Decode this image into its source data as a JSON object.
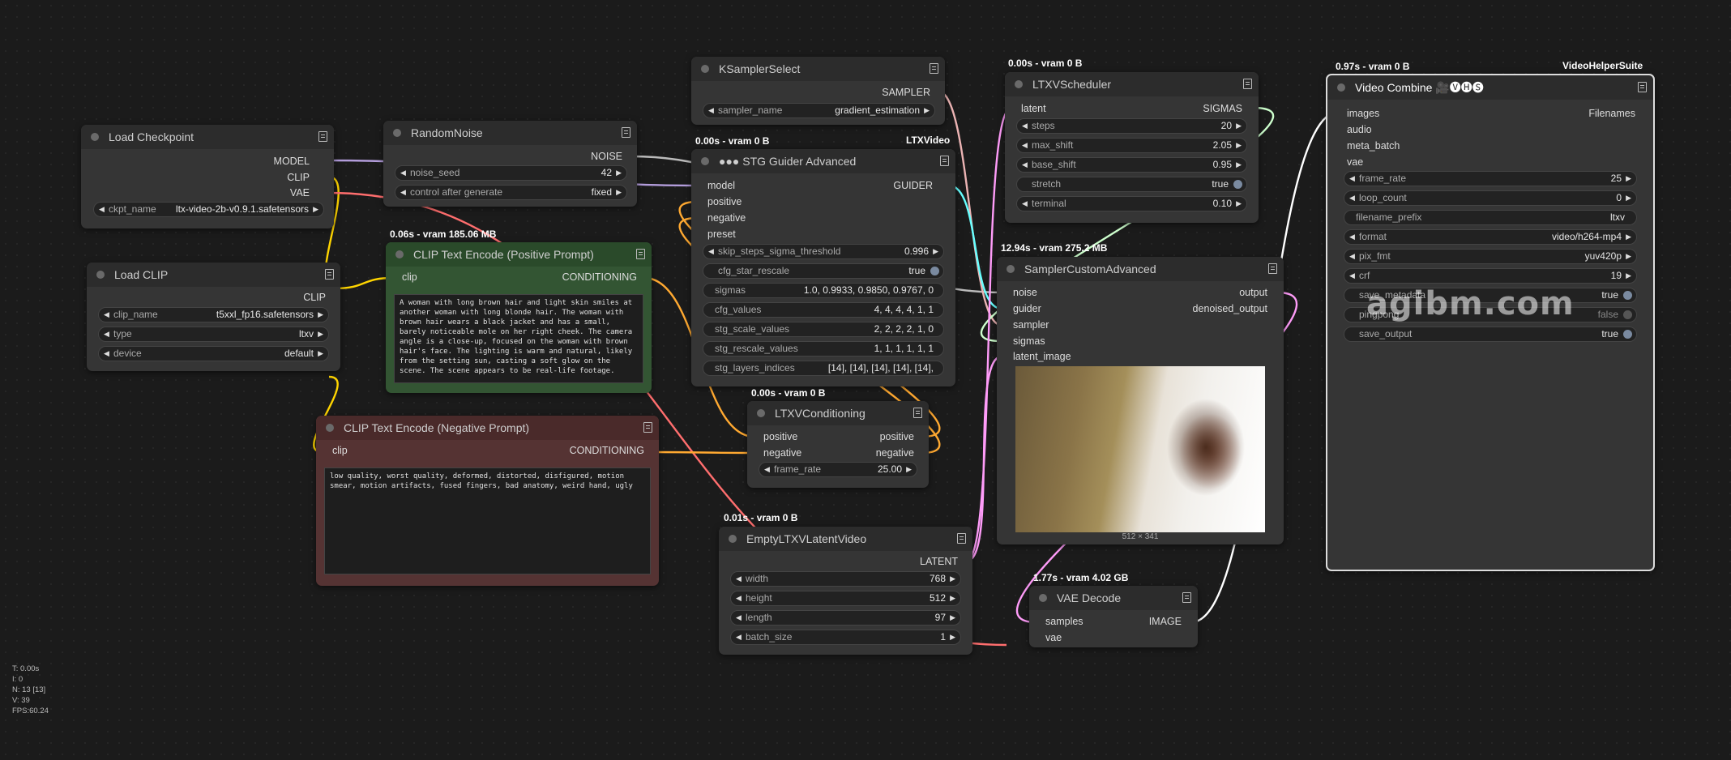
{
  "colors": {
    "model": "#b39ddb",
    "clip": "#ffd500",
    "vae": "#ff6e6e",
    "conditioning": "#ffa931",
    "latent": "#ff9cf9",
    "noise": "#bbbbbb",
    "guider": "#66ffff",
    "sigmas": "#cdffcd",
    "image": "#64b5f6",
    "sampler": "#ecb4b4"
  },
  "nodes": {
    "load_checkpoint": {
      "title": "Load Checkpoint",
      "outputs": [
        "MODEL",
        "CLIP",
        "VAE"
      ],
      "ckpt_name": {
        "name": "ckpt_name",
        "value": "ltx-video-2b-v0.9.1.safetensors"
      }
    },
    "random_noise": {
      "title": "RandomNoise",
      "output": "NOISE",
      "noise_seed": {
        "name": "noise_seed",
        "value": "42"
      },
      "control": {
        "name": "control after generate",
        "value": "fixed"
      }
    },
    "ksampler_select": {
      "title": "KSamplerSelect",
      "output": "SAMPLER",
      "sampler_name": {
        "name": "sampler_name",
        "value": "gradient_estimation"
      }
    },
    "stg_guider": {
      "badge": "0.00s - vram 0 B",
      "group": "LTXVideo",
      "title": "●●● STG Guider Advanced",
      "inputs": [
        "model",
        "positive",
        "negative",
        "preset"
      ],
      "output": "GUIDER",
      "widgets": [
        {
          "name": "skip_steps_sigma_threshold",
          "value": "0.996"
        },
        {
          "name": "cfg_star_rescale",
          "value": "true"
        },
        {
          "name": "sigmas",
          "value": "1.0, 0.9933, 0.9850, 0.9767, 0"
        },
        {
          "name": "cfg_values",
          "value": "4, 4, 4, 4, 1, 1"
        },
        {
          "name": "stg_scale_values",
          "value": "2, 2, 2, 2, 1, 0"
        },
        {
          "name": "stg_rescale_values",
          "value": "1, 1, 1, 1, 1, 1"
        },
        {
          "name": "stg_layers_indices",
          "value": "[14], [14], [14], [14], [14],"
        }
      ]
    },
    "ltxv_scheduler": {
      "badge": "0.00s - vram 0 B",
      "title": "LTXVScheduler",
      "input": "latent",
      "output": "SIGMAS",
      "widgets": [
        {
          "name": "steps",
          "value": "20"
        },
        {
          "name": "max_shift",
          "value": "2.05"
        },
        {
          "name": "base_shift",
          "value": "0.95"
        },
        {
          "name": "stretch",
          "value": "true"
        },
        {
          "name": "terminal",
          "value": "0.10"
        }
      ]
    },
    "video_combine": {
      "badge": "0.97s - vram 0 B",
      "group": "VideoHelperSuite",
      "title": "Video Combine 🎥🅥🅗🅢",
      "inputs": [
        "images",
        "audio",
        "meta_batch",
        "vae"
      ],
      "output": "Filenames",
      "widgets": [
        {
          "name": "frame_rate",
          "value": "25"
        },
        {
          "name": "loop_count",
          "value": "0"
        },
        {
          "name": "filename_prefix",
          "value": "ltxv"
        },
        {
          "name": "format",
          "value": "video/h264-mp4"
        },
        {
          "name": "pix_fmt",
          "value": "yuv420p"
        },
        {
          "name": "crf",
          "value": "19"
        },
        {
          "name": "save_metadata",
          "value": "true"
        },
        {
          "name": "pingpong",
          "value": "false"
        },
        {
          "name": "save_output",
          "value": "true"
        }
      ]
    },
    "load_clip": {
      "title": "Load CLIP",
      "output": "CLIP",
      "widgets": [
        {
          "name": "clip_name",
          "value": "t5xxl_fp16.safetensors"
        },
        {
          "name": "type",
          "value": "ltxv"
        },
        {
          "name": "device",
          "value": "default"
        }
      ]
    },
    "clip_pos": {
      "badge": "0.06s - vram 185.06 MB",
      "title": "CLIP Text Encode (Positive Prompt)",
      "input": "clip",
      "output": "CONDITIONING",
      "text": "A woman with long brown hair and light skin smiles at another woman with long blonde hair. The woman with brown hair wears a black jacket and has a small, barely noticeable mole on her right cheek. The camera angle is a close-up, focused on the woman with brown hair's face. The lighting is warm and natural, likely from the setting sun, casting a soft glow on the scene. The scene appears to be real-life footage."
    },
    "clip_neg": {
      "title": "CLIP Text Encode (Negative Prompt)",
      "input": "clip",
      "output": "CONDITIONING",
      "text": "low quality, worst quality, deformed, distorted, disfigured, motion smear, motion artifacts, fused fingers, bad anatomy, weird hand, ugly"
    },
    "sampler_custom": {
      "badge": "12.94s - vram 275.2 MB",
      "title": "SamplerCustomAdvanced",
      "inputs": [
        "noise",
        "guider",
        "sampler",
        "sigmas",
        "latent_image"
      ],
      "outputs": [
        "output",
        "denoised_output"
      ],
      "preview_size": "512 × 341"
    },
    "ltxv_conditioning": {
      "badge": "0.00s - vram 0 B",
      "title": "LTXVConditioning",
      "inputs": [
        "positive",
        "negative"
      ],
      "outputs": [
        "positive",
        "negative"
      ],
      "frame_rate": {
        "name": "frame_rate",
        "value": "25.00"
      }
    },
    "empty_latent": {
      "badge": "0.01s - vram 0 B",
      "title": "EmptyLTXVLatentVideo",
      "output": "LATENT",
      "widgets": [
        {
          "name": "width",
          "value": "768"
        },
        {
          "name": "height",
          "value": "512"
        },
        {
          "name": "length",
          "value": "97"
        },
        {
          "name": "batch_size",
          "value": "1"
        }
      ]
    },
    "vae_decode": {
      "badge": "1.77s - vram 4.02 GB",
      "title": "VAE Decode",
      "inputs": [
        "samples",
        "vae"
      ],
      "output": "IMAGE"
    }
  },
  "stats": {
    "t": "T: 0.00s",
    "i": "I: 0",
    "n": "N: 13 [13]",
    "v": "V: 39",
    "fps": "FPS:60.24"
  },
  "watermark": "agibm.com"
}
